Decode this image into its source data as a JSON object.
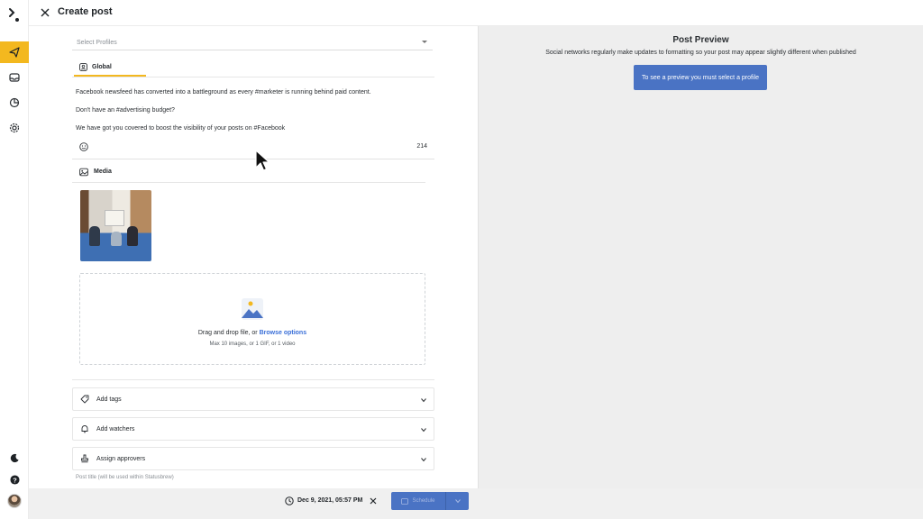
{
  "header": {
    "title": "Create post"
  },
  "editor": {
    "select_profiles_placeholder": "Select Profiles",
    "tab_label": "Global",
    "post_lines": [
      "Facebook newsfeed has converted into a battleground as every #marketer is running behind paid content.",
      "Don't have an #advertising budget?",
      "We have got you covered to boost the visibility of your posts on #Facebook"
    ],
    "char_count": "214",
    "media_label": "Media",
    "dropzone": {
      "text": "Drag and drop file, or",
      "link": "Browse options",
      "limits": "Max 10 images, or 1 GIF, or 1 video"
    },
    "accordions": [
      {
        "label": "Add tags",
        "icon": "tag-icon"
      },
      {
        "label": "Add watchers",
        "icon": "bell-icon"
      },
      {
        "label": "Assign approvers",
        "icon": "stamp-icon"
      }
    ],
    "cut_off_label": "Post title (will be used within Statusbrew)"
  },
  "footer": {
    "datetime": "Dec 9, 2021, 05:57 PM",
    "schedule_label": "Schedule"
  },
  "preview": {
    "title": "Post Preview",
    "subtitle": "Social networks regularly make updates to formatting so your post may appear slightly different when published",
    "button": "To see a preview you must select a profile"
  },
  "sidebar": {
    "items": [
      "logo-icon",
      "paper-plane-icon",
      "inbox-icon",
      "analytics-icon",
      "settings-icon",
      "dark-mode-icon",
      "help-icon",
      "avatar"
    ]
  },
  "colors": {
    "accent": "#f3b81f",
    "primary": "#4a73c4",
    "link": "#3a6fd8"
  }
}
